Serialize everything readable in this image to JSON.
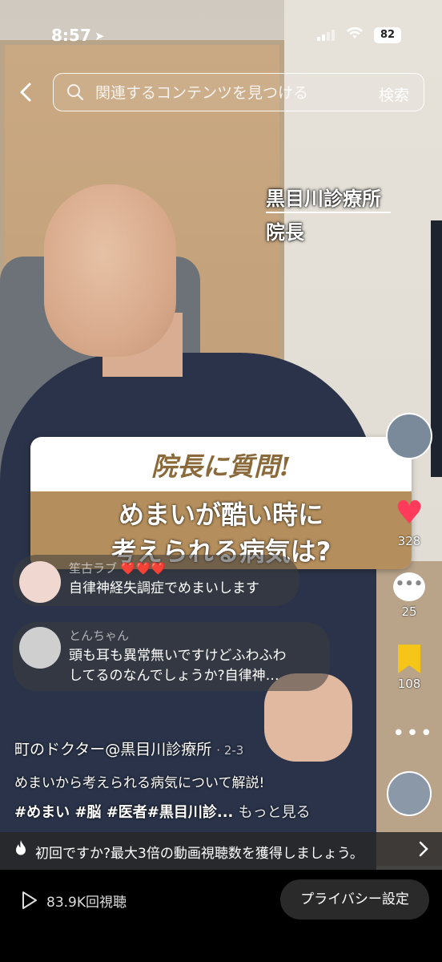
{
  "status_bar": {
    "time": "8:57",
    "battery": "82"
  },
  "search": {
    "placeholder": "関連するコンテンツを見つける",
    "button": "検索"
  },
  "video_overlay": {
    "clinic": "黒目川診療所",
    "role": "院長"
  },
  "question_card": {
    "title": "院長に質問!",
    "line1": "めまいが酷い時に",
    "line2": "考えられる病気は?"
  },
  "actions": {
    "likes": "328",
    "comments": "25",
    "saves": "108"
  },
  "comments": [
    {
      "user": "笙古ラブ",
      "hearts": "❤️❤️❤️",
      "text": "自律神経失調症でめまいします"
    },
    {
      "user": "とんちゃん",
      "text_line1": "頭も耳も異常無いですけどふわふわ",
      "text_line2": "してるのなんでしょうか?自律神…"
    }
  ],
  "caption": {
    "author": "町のドクター@黒目川診療所",
    "date": "· 2-3",
    "description": "めまいから考えられる病気について解説!",
    "tags": "#めまい #脳 #医者#黒目川診...",
    "more": "もっと見る"
  },
  "promo": {
    "text": "初回ですか?最大3倍の動画視聴数を獲得しましょう。"
  },
  "bottom": {
    "views": "83.9K回視聴",
    "privacy": "プライバシー設定"
  },
  "colors": {
    "heart": "#ff3b5c",
    "bookmark": "#f5c518",
    "card_band": "#b48e5c"
  }
}
